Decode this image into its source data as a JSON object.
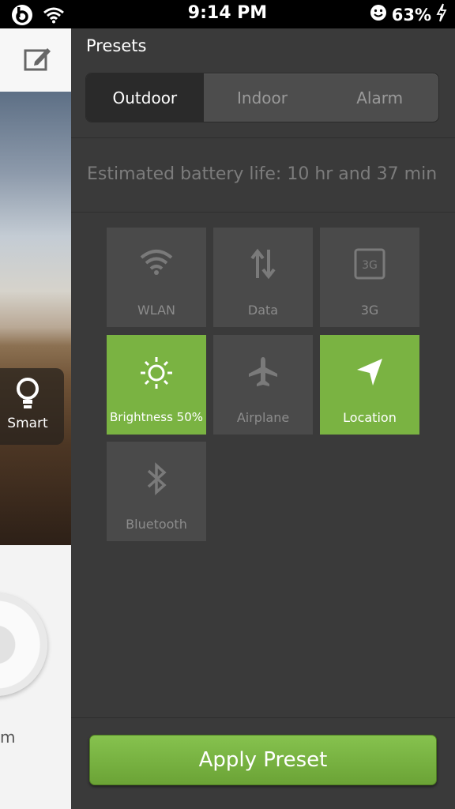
{
  "status_bar": {
    "time": "9:14 PM",
    "battery": "63%"
  },
  "left_card": {
    "smart_label": "Smart",
    "bottom_text": "m"
  },
  "panel": {
    "title": "Presets",
    "tabs": [
      {
        "label": "Outdoor",
        "active": true
      },
      {
        "label": "Indoor",
        "active": false
      },
      {
        "label": "Alarm",
        "active": false
      }
    ],
    "battery_estimate": "Estimated battery life: 10 hr and 37 min",
    "tiles": [
      {
        "label": "WLAN",
        "icon": "wifi-icon",
        "on": false
      },
      {
        "label": "Data",
        "icon": "data-arrows-icon",
        "on": false
      },
      {
        "label": "3G",
        "icon": "3g-icon",
        "on": false
      },
      {
        "label": "Brightness 50%",
        "icon": "sun-icon",
        "on": true
      },
      {
        "label": "Airplane",
        "icon": "airplane-icon",
        "on": false
      },
      {
        "label": "Location",
        "icon": "location-arrow-icon",
        "on": true
      },
      {
        "label": "Bluetooth",
        "icon": "bluetooth-icon",
        "on": false
      }
    ],
    "apply_label": "Apply Preset"
  },
  "colors": {
    "accent_green": "#7ab342",
    "panel_bg": "#3a3a3a",
    "tile_off": "#4a4a4a"
  }
}
